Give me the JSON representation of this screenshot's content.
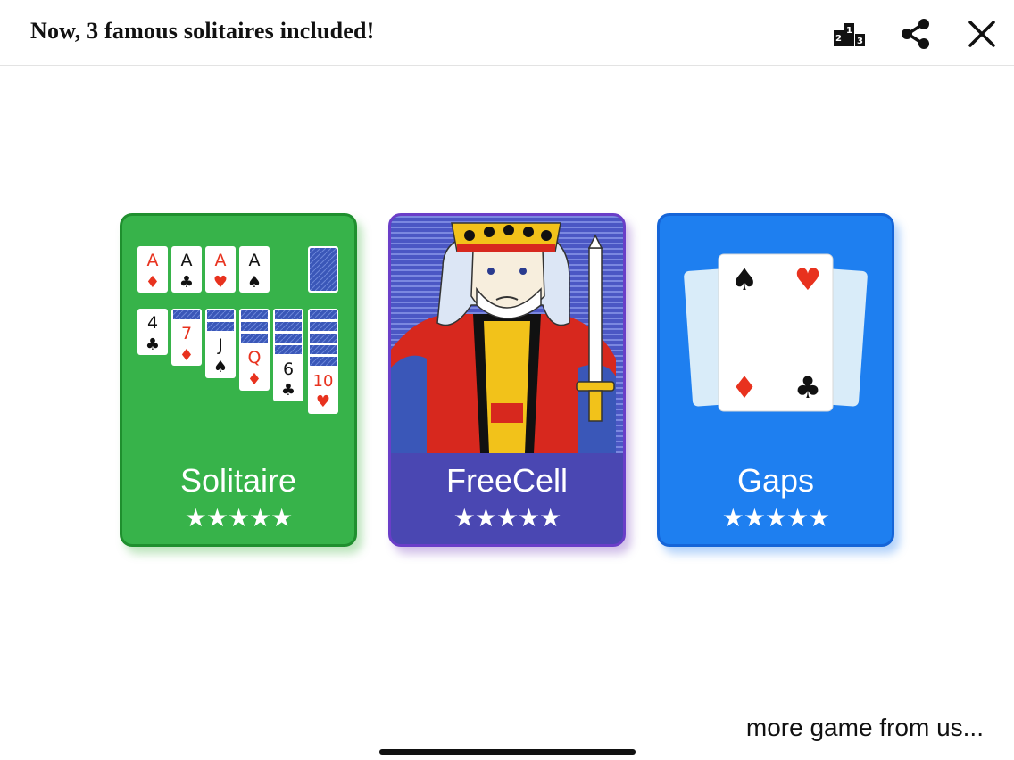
{
  "header": {
    "title": "Now, 3 famous solitaires included!",
    "icons": [
      "ranking-icon",
      "share-icon",
      "close-icon"
    ]
  },
  "games": [
    {
      "name": "Solitaire",
      "stars": "★★★★★",
      "rating": 5,
      "color": "#37b34a"
    },
    {
      "name": "FreeCell",
      "stars": "★★★★★",
      "rating": 5,
      "color": "#4a47b2"
    },
    {
      "name": "Gaps",
      "stars": "★★★★★",
      "rating": 5,
      "color": "#1e7ff0"
    }
  ],
  "solitaire_art": {
    "foundation": [
      "A",
      "A",
      "A",
      "A"
    ],
    "tableau": [
      "4",
      "7",
      "J",
      "Q",
      "6",
      "10"
    ]
  },
  "footer": {
    "more_label": "more game from us..."
  },
  "colors": {
    "red_suit": "#e8321e",
    "black_suit": "#111111"
  }
}
